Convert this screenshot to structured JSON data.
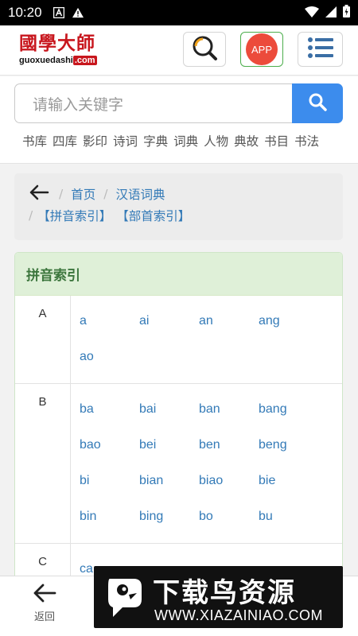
{
  "status_bar": {
    "time": "10:20"
  },
  "header": {
    "logo_cn": "國學大師",
    "logo_en_prefix": "guoxuedashi",
    "logo_en_suffix": ".com",
    "app_label": "APP"
  },
  "search": {
    "placeholder": "请输入关键字",
    "categories": [
      "书库",
      "四库",
      "影印",
      "诗词",
      "字典",
      "词典",
      "人物",
      "典故",
      "书目",
      "书法"
    ]
  },
  "breadcrumb": {
    "home": "首页",
    "section": "汉语词典",
    "pinyin_index": "【拼音索引】",
    "radical_index": "【部首索引】",
    "separator": "/"
  },
  "index_panel": {
    "title": "拼音索引",
    "groups": [
      {
        "letter": "A",
        "items": [
          "a",
          "ai",
          "an",
          "ang",
          "ao"
        ]
      },
      {
        "letter": "B",
        "items": [
          "ba",
          "bai",
          "ban",
          "bang",
          "bao",
          "bei",
          "ben",
          "beng",
          "bi",
          "bian",
          "biao",
          "bie",
          "bin",
          "bing",
          "bo",
          "bu"
        ]
      },
      {
        "letter": "C",
        "items": [
          "ca"
        ]
      }
    ]
  },
  "bottom_nav": {
    "back_label": "返回"
  },
  "watermark": {
    "title": "下载鸟资源",
    "url": "WWW.XIAZAINIAO.COM"
  },
  "colors": {
    "accent": "#3c8ced",
    "brand_red": "#c8161d",
    "link": "#337ab7",
    "panel_head": "#dff0d8"
  }
}
